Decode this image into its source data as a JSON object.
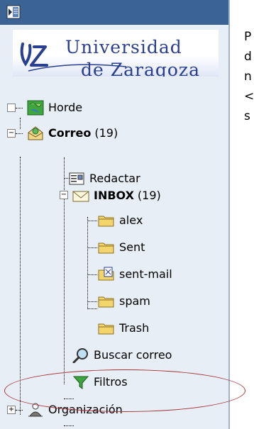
{
  "logo": {
    "line1": "Universidad",
    "line2": "de Zaragoza"
  },
  "tree": {
    "horde": {
      "label": "Horde",
      "icon": "horde-map-icon"
    },
    "correo": {
      "label": "Correo",
      "count": "(19)",
      "icon": "mail-home-icon",
      "expanded": true
    },
    "redactar": {
      "label": "Redactar",
      "icon": "compose-icon"
    },
    "inbox": {
      "label": "INBOX",
      "count": "(19)",
      "icon": "envelope-icon",
      "expanded": true
    },
    "folders": [
      {
        "label": "alex",
        "icon": "folder-icon"
      },
      {
        "label": "Sent",
        "icon": "folder-icon"
      },
      {
        "label": "sent-mail",
        "icon": "sent-mail-folder-icon"
      },
      {
        "label": "spam",
        "icon": "folder-icon"
      },
      {
        "label": "Trash",
        "icon": "folder-icon"
      }
    ],
    "buscar": {
      "label": "Buscar correo",
      "icon": "magnifier-icon",
      "highlighted": true
    },
    "filtros": {
      "label": "Filtros",
      "icon": "filter-icon"
    },
    "organizacion": {
      "label": "Organización",
      "icon": "organization-icon",
      "expanded": false
    }
  },
  "content": {
    "lines": [
      "P",
      "d",
      "n",
      "<",
      "s"
    ]
  },
  "colors": {
    "topbar": "#3b6494",
    "sidebar_bg": "#e7eef6",
    "highlight": "#a8323a",
    "logo_text": "#2a3f8f"
  }
}
